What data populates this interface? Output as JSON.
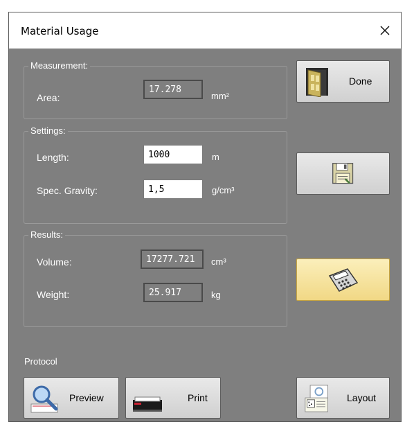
{
  "window": {
    "title": "Material Usage"
  },
  "measurement": {
    "label": "Measurement:",
    "area_label": "Area:",
    "area_value": "17.278",
    "area_unit": "mm²"
  },
  "settings": {
    "label": "Settings:",
    "length_label": "Length:",
    "length_value": "1000",
    "length_unit": "m",
    "gravity_label": "Spec. Gravity:",
    "gravity_value": "1,5",
    "gravity_unit": "g/cm³"
  },
  "results": {
    "label": "Results:",
    "volume_label": "Volume:",
    "volume_value": "17277.721",
    "volume_unit": "cm³",
    "weight_label": "Weight:",
    "weight_value": "25.917",
    "weight_unit": "kg"
  },
  "buttons": {
    "done_label": "Done",
    "preview_label": "Preview",
    "print_label": "Print",
    "layout_label": "Layout"
  },
  "protocol": {
    "label": "Protocol"
  },
  "icons": {
    "close": "close-icon",
    "done": "door-exit-icon",
    "save": "floppy-disk-icon",
    "calculate": "calculator-icon",
    "preview": "magnifier-icon",
    "print": "printer-icon",
    "layout": "page-layout-icon"
  },
  "colors": {
    "dialog_background": "#7f7f7f",
    "calculate_highlight": "#f6e39c"
  }
}
